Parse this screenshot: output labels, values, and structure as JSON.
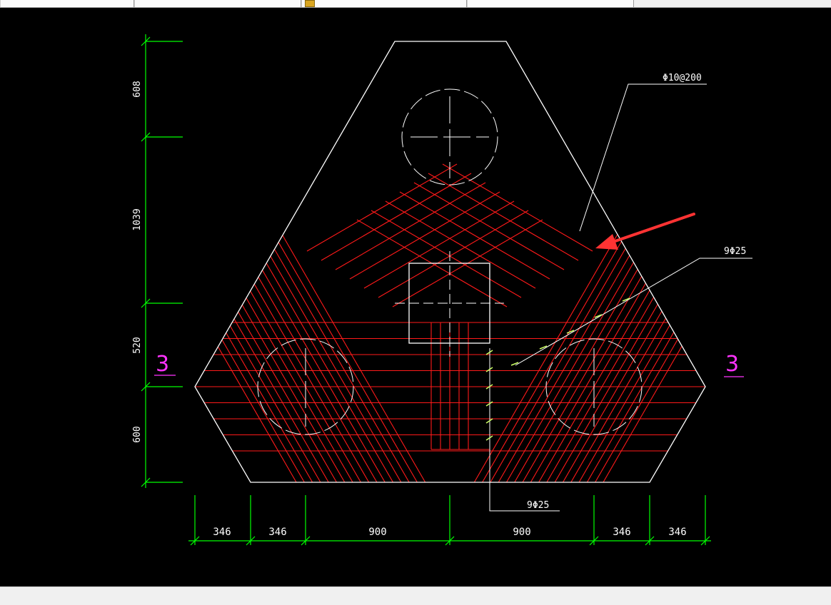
{
  "tabs": [
    {
      "label": ""
    },
    {
      "label": ""
    },
    {
      "label": ""
    },
    {
      "label": ""
    }
  ],
  "dimensions": {
    "vertical": [
      "608",
      "1039",
      "520",
      "600"
    ],
    "horizontal": [
      "346",
      "346",
      "900",
      "900",
      "346",
      "346"
    ]
  },
  "annotations": {
    "stirrup": "Φ10@200",
    "rebar_right": "9Φ25",
    "rebar_bottom": "9Φ25"
  },
  "section_marks": {
    "left": "3",
    "right": "3"
  },
  "colors": {
    "background": "#000000",
    "outline": "#ffffff",
    "rebar": "#ff1a1a",
    "dimension": "#00ff00",
    "section": "#ff33ff",
    "arrow": "#ff3333"
  }
}
